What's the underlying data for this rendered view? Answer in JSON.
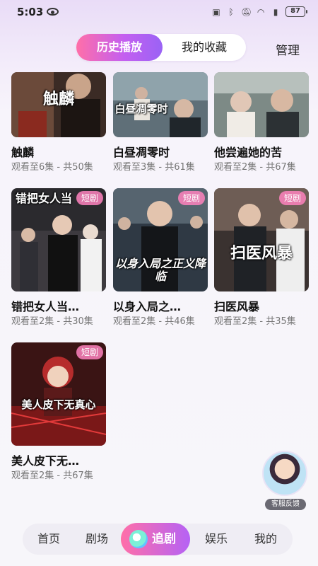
{
  "status": {
    "time": "5:03",
    "battery": "87"
  },
  "tabs": {
    "history": "历史播放",
    "favorites": "我的收藏",
    "manage": "管理"
  },
  "badge_label": "短剧",
  "dramas": [
    {
      "title": "触麟",
      "progress": "观看至6集 - 共50集",
      "poster_text": "触麟"
    },
    {
      "title": "白昼凋零时",
      "progress": "观看至3集 - 共61集",
      "poster_text": "白昼凋零时"
    },
    {
      "title": "他尝遍她的苦",
      "progress": "观看至2集 - 共67集",
      "poster_text": ""
    },
    {
      "title": "错把女人当…",
      "progress": "观看至2集 - 共30集",
      "poster_text": "错把女人当",
      "badge": true
    },
    {
      "title": "以身入局之…",
      "progress": "观看至2集 - 共46集",
      "poster_text": "以身入局之正义降临",
      "badge": true
    },
    {
      "title": "扫医风暴",
      "progress": "观看至2集 - 共35集",
      "poster_text": "扫医风暴",
      "badge": true
    },
    {
      "title": "美人皮下无…",
      "progress": "观看至2集 - 共67集",
      "poster_text": "美人皮下无真心",
      "badge": true
    }
  ],
  "float_service": {
    "label": "客服反馈"
  },
  "nav": {
    "home": "首页",
    "theater": "剧场",
    "follow": "追剧",
    "entertainment": "娱乐",
    "mine": "我的"
  }
}
